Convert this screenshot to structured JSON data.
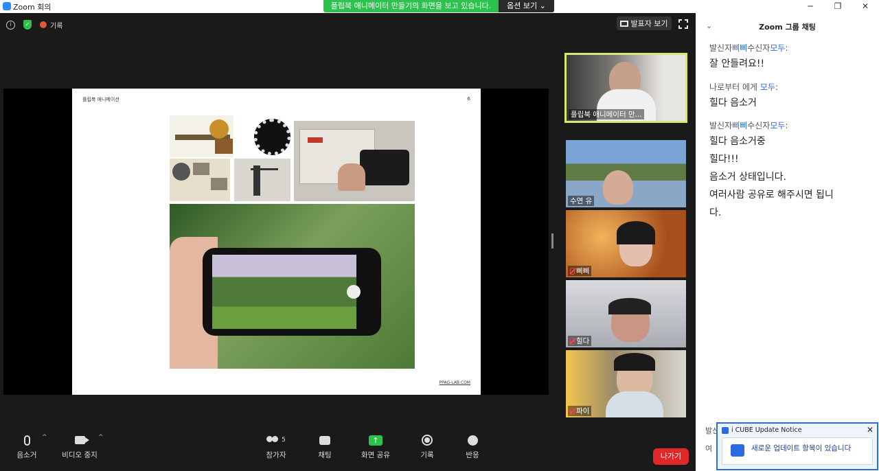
{
  "window": {
    "title": "Zoom 회의",
    "minimize": "─",
    "maximize": "❐",
    "close": "✕"
  },
  "share_banner": {
    "text": "플립북 애니메이터 만들기의 화면을 보고 있습니다.",
    "options_label": "옵션 보기 ⌄"
  },
  "top_bar": {
    "info": "i",
    "shield": "✓",
    "recording_label": "기록",
    "speaker_view_label": "발표자 보기"
  },
  "slide": {
    "title": "플립북 애니메이션",
    "page_number": "6",
    "footer": "PPAG-LAB.COM"
  },
  "participants": [
    {
      "name": "플립북 애니메이터 만...",
      "muted": false,
      "active": true
    },
    {
      "name": "수연 유",
      "muted": false,
      "active": false
    },
    {
      "name": "삐삐",
      "muted": true,
      "active": false
    },
    {
      "name": "힐다",
      "muted": true,
      "active": false
    },
    {
      "name": "파이",
      "muted": true,
      "active": false
    }
  ],
  "toolbar": {
    "audio": "음소거",
    "video": "비디오 중지",
    "participants": "참가자",
    "participants_count": "5",
    "chat": "채팅",
    "share": "화면 공유",
    "record": "기록",
    "reactions": "반응",
    "leave": "나가기",
    "caret": "^"
  },
  "chat": {
    "title": "Zoom 그룹 채팅",
    "chevron": "⌄",
    "messages": [
      {
        "prefix": "발신자",
        "sender": "삐삐",
        "mid": "수신자",
        "recipient": "모두",
        "suffix": ":",
        "lines": [
          "잘 안들려요!!"
        ]
      },
      {
        "prefix": "나로부터 에게 ",
        "sender": "",
        "mid": "",
        "recipient": "모두",
        "suffix": ":",
        "lines": [
          "힐다 음소거"
        ]
      },
      {
        "prefix": "발신자",
        "sender": "삐삐",
        "mid": "수신자",
        "recipient": "모두",
        "suffix": ":",
        "lines": [
          "힐다 음소거중",
          "힐다!!!",
          "음소거 상태입니다.",
          "여러사람 공유로 해주시면 됩니",
          "다."
        ]
      }
    ],
    "input_hint_1": "발신",
    "input_hint_2": "여"
  },
  "notice": {
    "title": "i CUBE Update Notice",
    "message": "새로운 업데이트 항목이 있습니다",
    "close": "✕"
  }
}
